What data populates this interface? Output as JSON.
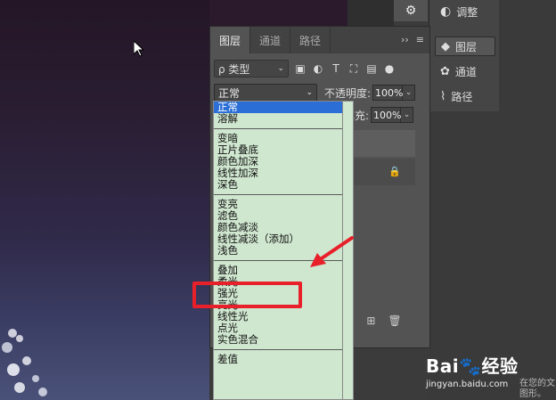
{
  "panel": {
    "tabs": [
      {
        "label": "图层"
      },
      {
        "label": "通道"
      },
      {
        "label": "路径"
      }
    ],
    "filter_label": "ρ 类型",
    "blend_mode": "正常",
    "opacity_label": "不透明度:",
    "opacity_value": "100%",
    "fill_label": "填充:",
    "fill_value": "100%"
  },
  "dock": {
    "adjust_label": "调整",
    "layers_label": "图层",
    "channels_label": "通道",
    "paths_label": "路径"
  },
  "blend_menu": {
    "groups": [
      [
        "正常",
        "溶解"
      ],
      [
        "变暗",
        "正片叠底",
        "颜色加深",
        "线性加深",
        "深色"
      ],
      [
        "变亮",
        "滤色",
        "颜色减淡",
        "线性减淡（添加）",
        "浅色"
      ],
      [
        "叠加",
        "柔光",
        "强光",
        "亮光",
        "线性光",
        "点光",
        "实色混合"
      ],
      [
        "差值"
      ]
    ],
    "selected": "正常",
    "highlighted": "叠加"
  },
  "watermark": {
    "logo": "Bai🐾经验",
    "url": "jingyan.baidu.com"
  },
  "corner_text": [
    "在您的文",
    "图形。"
  ],
  "colors": {
    "highlight_box": "#e8202a",
    "menu_bg": "#cfe6cf",
    "selected_item": "#2b6fd6"
  }
}
